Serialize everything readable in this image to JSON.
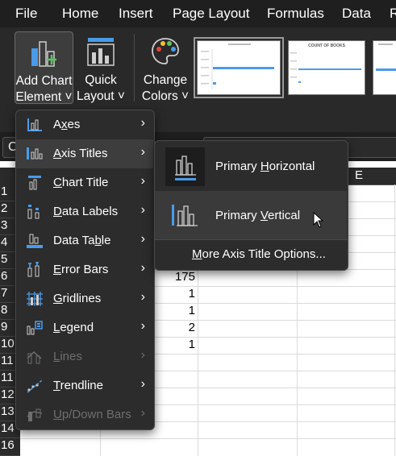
{
  "ribbon": {
    "tabs": [
      "File",
      "Home",
      "Insert",
      "Page Layout",
      "Formulas",
      "Data",
      "R"
    ],
    "buttons": {
      "add_chart_element": [
        "Add Chart",
        "Element ˅"
      ],
      "quick_layout": [
        "Quick",
        "Layout ˅"
      ],
      "change_colors": [
        "Change",
        "Colors ˅"
      ]
    },
    "name_box_fragment": "C"
  },
  "grid": {
    "column_header": "E",
    "row_numbers": [
      "1",
      "2",
      "3",
      "4",
      "5",
      "6",
      "7",
      "8",
      "9",
      "10",
      "11",
      "12",
      "13",
      "14",
      "15",
      "16"
    ],
    "values": [
      "175",
      "1",
      "1",
      "2",
      "1"
    ]
  },
  "chart_element_menu": {
    "items": [
      {
        "pre": "A",
        "u": "x",
        "post": "es",
        "enabled": true
      },
      {
        "pre": "",
        "u": "A",
        "post": "xis Titles",
        "enabled": true,
        "highlighted": true
      },
      {
        "pre": "",
        "u": "C",
        "post": "hart Title",
        "enabled": true
      },
      {
        "pre": "",
        "u": "D",
        "post": "ata Labels",
        "enabled": true
      },
      {
        "pre": "Data Ta",
        "u": "b",
        "post": "le",
        "enabled": true
      },
      {
        "pre": "",
        "u": "E",
        "post": "rror Bars",
        "enabled": true
      },
      {
        "pre": "",
        "u": "G",
        "post": "ridlines",
        "enabled": true
      },
      {
        "pre": "",
        "u": "L",
        "post": "egend",
        "enabled": true
      },
      {
        "pre": "",
        "u": "L",
        "post": "ines",
        "enabled": false
      },
      {
        "pre": "",
        "u": "T",
        "post": "rendline",
        "enabled": true
      },
      {
        "pre": "",
        "u": "U",
        "post": "p/Down Bars",
        "enabled": false
      }
    ]
  },
  "axis_titles_submenu": {
    "primary_horizontal": {
      "pre": "Primary ",
      "u": "H",
      "post": "orizontal"
    },
    "primary_vertical": {
      "pre": "Primary ",
      "u": "V",
      "post": "ertical"
    },
    "more_options": {
      "pre": "",
      "u": "M",
      "post": "ore Axis Title Options..."
    }
  },
  "thumbnails": {
    "count_of_books": "COUNT OF BOOKS"
  },
  "colors": {
    "accent_blue": "#4a9be8",
    "menu_bg": "#2c2c2c",
    "ribbon_bg": "#292929"
  }
}
